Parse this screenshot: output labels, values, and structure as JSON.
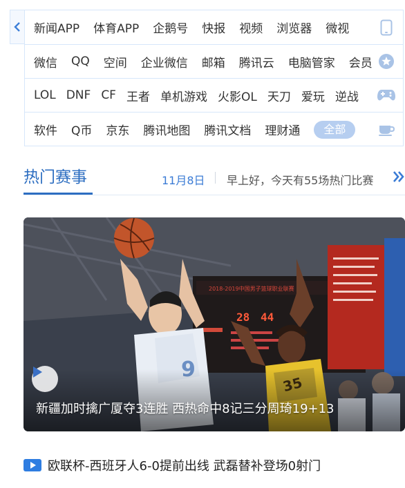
{
  "nav": {
    "back_icon": "chevron-left-icon",
    "rows": [
      {
        "items": [
          "新闻APP",
          "体育APP",
          "企鹅号",
          "快报",
          "视频",
          "浏览器",
          "微视"
        ],
        "icon": "phone-icon"
      },
      {
        "items": [
          "微信",
          "QQ",
          "空间",
          "企业微信",
          "邮箱",
          "腾讯云",
          "电脑管家",
          "会员"
        ],
        "icon": "star-icon"
      },
      {
        "items": [
          "LOL",
          "DNF",
          "CF",
          "王者",
          "单机游戏",
          "火影OL",
          "天刀",
          "爱玩",
          "逆战"
        ],
        "icon": "gamepad-icon"
      },
      {
        "items": [
          "软件",
          "Q币",
          "京东",
          "腾讯地图",
          "腾讯文档",
          "理财通"
        ],
        "all_label": "全部",
        "icon": "cup-icon"
      }
    ]
  },
  "hot": {
    "title": "热门赛事",
    "date": "11月8日",
    "greeting": "早上好，今天有55场热门比赛",
    "more_icon": "double-chevron-right-icon"
  },
  "card": {
    "caption": "新疆加时擒广厦夺3连胜 西热命中8记三分周琦19+13",
    "scoreboard": {
      "left_score": "28",
      "right_score": "44",
      "banner": "2018-2019中国男子篮球职业联赛"
    },
    "jersey_left": "9",
    "jersey_right": "35",
    "play_icon": "play-icon"
  },
  "news": {
    "icon": "video-icon",
    "text": "欧联杯-西班牙人6-0提前出线 武磊替补登场0射门"
  },
  "colors": {
    "accent": "#2d6ec1",
    "border": "#d6e6fa",
    "pill": "#b6cef0"
  }
}
